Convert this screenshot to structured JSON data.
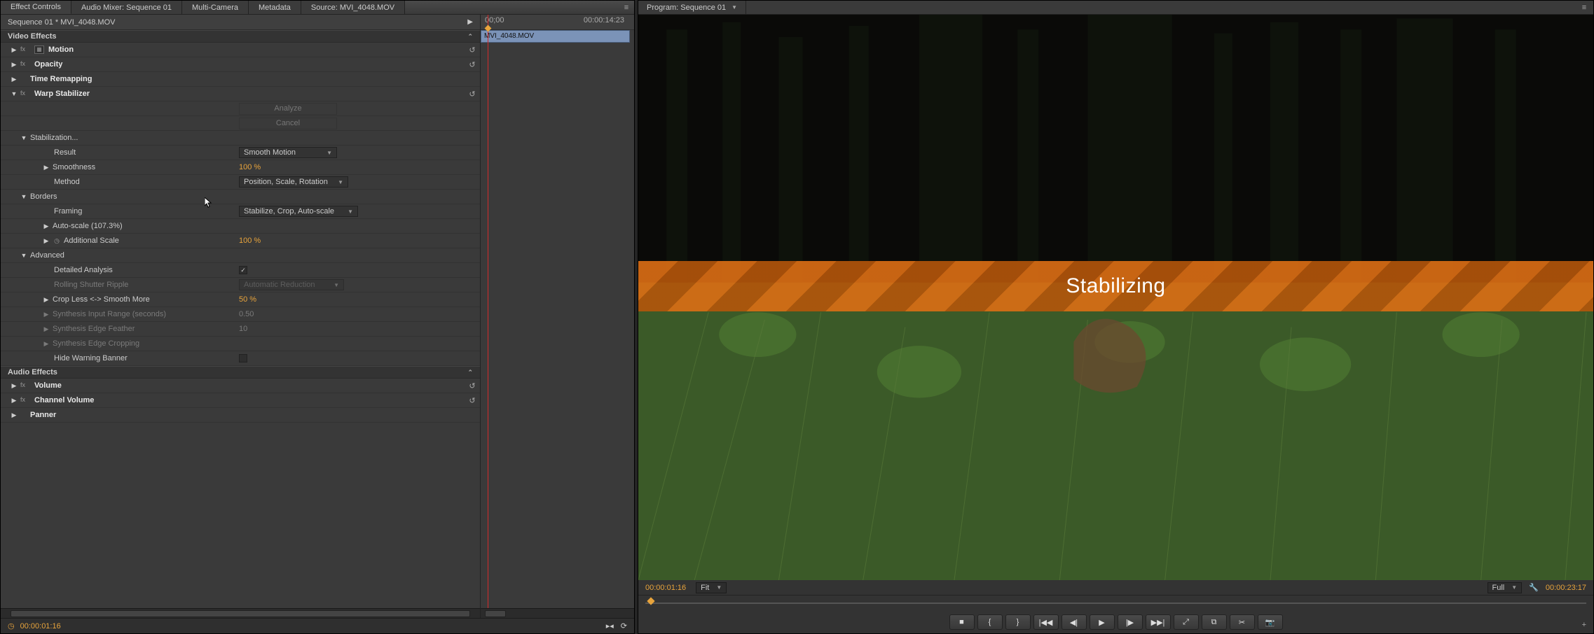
{
  "left": {
    "tabs": [
      "Effect Controls",
      "Audio Mixer: Sequence 01",
      "Multi-Camera",
      "Metadata",
      "Source: MVI_4048.MOV"
    ],
    "active_tab": 0,
    "clip_title": "Sequence 01 * MVI_4048.MOV",
    "video_effects_label": "Video Effects",
    "audio_effects_label": "Audio Effects",
    "motion_label": "Motion",
    "opacity_label": "Opacity",
    "time_remapping_label": "Time Remapping",
    "warp_stabilizer": {
      "label": "Warp Stabilizer",
      "analyze_btn": "Analyze",
      "cancel_btn": "Cancel",
      "stabilization_label": "Stabilization...",
      "result_label": "Result",
      "result_value": "Smooth Motion",
      "smoothness_label": "Smoothness",
      "smoothness_value": "100 %",
      "method_label": "Method",
      "method_value": "Position, Scale, Rotation",
      "borders_label": "Borders",
      "framing_label": "Framing",
      "framing_value": "Stabilize, Crop, Auto-scale",
      "autoscale_label": "Auto-scale (107.3%)",
      "additional_scale_label": "Additional Scale",
      "additional_scale_value": "100 %",
      "advanced_label": "Advanced",
      "detailed_analysis_label": "Detailed Analysis",
      "detailed_analysis_checked": true,
      "rolling_shutter_label": "Rolling Shutter Ripple",
      "rolling_shutter_value": "Automatic Reduction",
      "crop_smooth_label": "Crop Less <-> Smooth More",
      "crop_smooth_value": "50 %",
      "synth_input_label": "Synthesis Input Range (seconds)",
      "synth_input_value": "0.50",
      "synth_edge_feather_label": "Synthesis Edge Feather",
      "synth_edge_feather_value": "10",
      "synth_edge_crop_label": "Synthesis Edge Cropping",
      "hide_banner_label": "Hide Warning Banner"
    },
    "volume_label": "Volume",
    "channel_volume_label": "Channel Volume",
    "panner_label": "Panner",
    "timecode": "00:00:01:16",
    "ruler_start": "00;00",
    "ruler_end": "00:00:14:23",
    "clip_name": "MVI_4048.MOV"
  },
  "right": {
    "tab_label": "Program: Sequence 01",
    "banner_text": "Stabilizing",
    "tc_left": "00:00:01:16",
    "fit_label": "Fit",
    "quality_label": "Full",
    "tc_right": "00:00:23:17",
    "transport_icons": [
      "■",
      "{",
      "}",
      "|◀◀",
      "◀|",
      "▶",
      "|▶",
      "▶▶|",
      "⤢",
      "⧉",
      "✂",
      "📷"
    ]
  }
}
